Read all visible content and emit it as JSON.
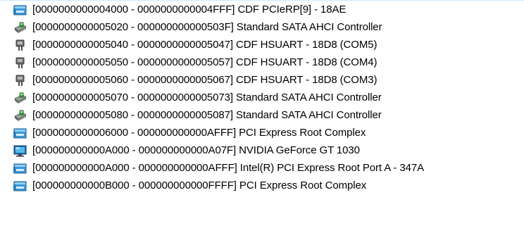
{
  "colors": {
    "text": "#000000",
    "background": "#ffffff",
    "selection_line": "#cde8ff"
  },
  "items": [
    {
      "text": "[0000000000004000 - 0000000000004FFF]  CDF PCIeRP[9] - 18AE",
      "icon": "pci-bus-icon"
    },
    {
      "text": "[0000000000005020 - 000000000000503F]  Standard SATA AHCI Controller",
      "icon": "storage-controller-icon"
    },
    {
      "text": "[0000000000005040 - 0000000000005047]  CDF HSUART - 18D8 (COM5)",
      "icon": "serial-port-icon"
    },
    {
      "text": "[0000000000005050 - 0000000000005057]  CDF HSUART - 18D8 (COM4)",
      "icon": "serial-port-icon"
    },
    {
      "text": "[0000000000005060 - 0000000000005067]  CDF HSUART - 18D8 (COM3)",
      "icon": "serial-port-icon"
    },
    {
      "text": "[0000000000005070 - 0000000000005073]  Standard SATA AHCI Controller",
      "icon": "storage-controller-icon"
    },
    {
      "text": "[0000000000005080 - 0000000000005087]  Standard SATA AHCI Controller",
      "icon": "storage-controller-icon"
    },
    {
      "text": "[0000000000006000 - 000000000000AFFF]  PCI Express Root Complex",
      "icon": "pci-bus-icon"
    },
    {
      "text": "[000000000000A000 - 000000000000A07F]  NVIDIA GeForce GT 1030",
      "icon": "display-adapter-icon"
    },
    {
      "text": "[000000000000A000 - 000000000000AFFF]  Intel(R) PCI Express Root Port A - 347A",
      "icon": "pci-bus-icon"
    },
    {
      "text": "[000000000000B000 - 000000000000FFFF]  PCI Express Root Complex",
      "icon": "pci-bus-icon"
    }
  ]
}
